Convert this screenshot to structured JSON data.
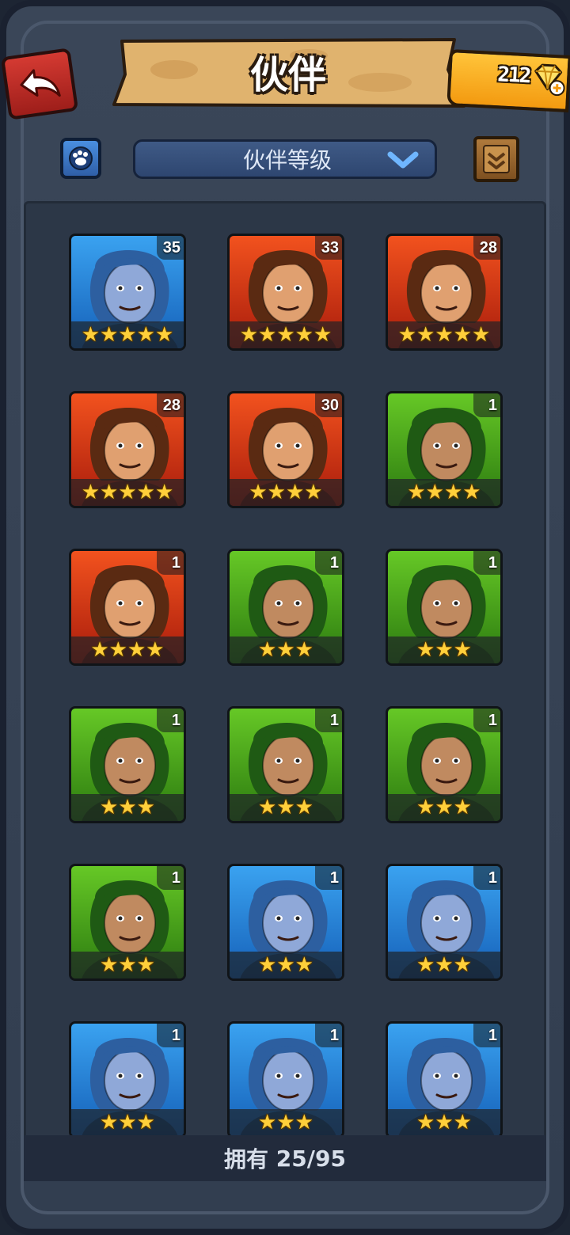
{
  "header": {
    "title": "伙伴",
    "gems": "212"
  },
  "toolbar": {
    "sort_label": "伙伴等级"
  },
  "footer": {
    "owned_label": "拥有",
    "owned_value": "25/95"
  },
  "colors": {
    "red_frame": "#d0341c",
    "green_frame": "#52b41c",
    "blue_frame": "#2a86e0",
    "star": "#ffcf3a",
    "gem_box": "#f7a820"
  },
  "heroes": [
    {
      "level": "35",
      "stars": "★★★★★",
      "star_count": 5,
      "frame": "blue",
      "icon": "blue-mammoth-portrait"
    },
    {
      "level": "33",
      "stars": "★★★★★",
      "star_count": 5,
      "frame": "red",
      "icon": "barbarian-man-portrait"
    },
    {
      "level": "28",
      "stars": "★★★★★",
      "star_count": 5,
      "frame": "red",
      "icon": "panda-portrait"
    },
    {
      "level": "28",
      "stars": "★★★★★",
      "star_count": 5,
      "frame": "red",
      "icon": "brown-hair-woman-portrait"
    },
    {
      "level": "30",
      "stars": "★★★★",
      "star_count": 4,
      "frame": "red",
      "icon": "red-hair-boy-portrait"
    },
    {
      "level": "1",
      "stars": "★★★★",
      "star_count": 4,
      "frame": "green",
      "icon": "afro-woman-portrait"
    },
    {
      "level": "1",
      "stars": "★★★★",
      "star_count": 4,
      "frame": "red",
      "icon": "red-hood-man-portrait"
    },
    {
      "level": "1",
      "stars": "★★★",
      "star_count": 3,
      "frame": "green",
      "icon": "green-crocodile-portrait"
    },
    {
      "level": "1",
      "stars": "★★★",
      "star_count": 3,
      "frame": "green",
      "icon": "green-crocodile-portrait"
    },
    {
      "level": "1",
      "stars": "★★★",
      "star_count": 3,
      "frame": "green",
      "icon": "green-beard-man-portrait"
    },
    {
      "level": "1",
      "stars": "★★★",
      "star_count": 3,
      "frame": "green",
      "icon": "ogre-portrait"
    },
    {
      "level": "1",
      "stars": "★★★",
      "star_count": 3,
      "frame": "green",
      "icon": "ogre-portrait"
    },
    {
      "level": "1",
      "stars": "★★★",
      "star_count": 3,
      "frame": "green",
      "icon": "green-boar-portrait"
    },
    {
      "level": "1",
      "stars": "★★★",
      "star_count": 3,
      "frame": "blue",
      "icon": "blue-hair-man-portrait"
    },
    {
      "level": "1",
      "stars": "★★★",
      "star_count": 3,
      "frame": "blue",
      "icon": "blonde-woman-portrait"
    },
    {
      "level": "1",
      "stars": "★★★",
      "star_count": 3,
      "frame": "blue",
      "icon": "blonde-woman-portrait"
    },
    {
      "level": "1",
      "stars": "★★★",
      "star_count": 3,
      "frame": "blue",
      "icon": "gray-wolf-portrait"
    },
    {
      "level": "1",
      "stars": "★★★",
      "star_count": 3,
      "frame": "blue",
      "icon": "blue-hair-woman-portrait"
    }
  ]
}
